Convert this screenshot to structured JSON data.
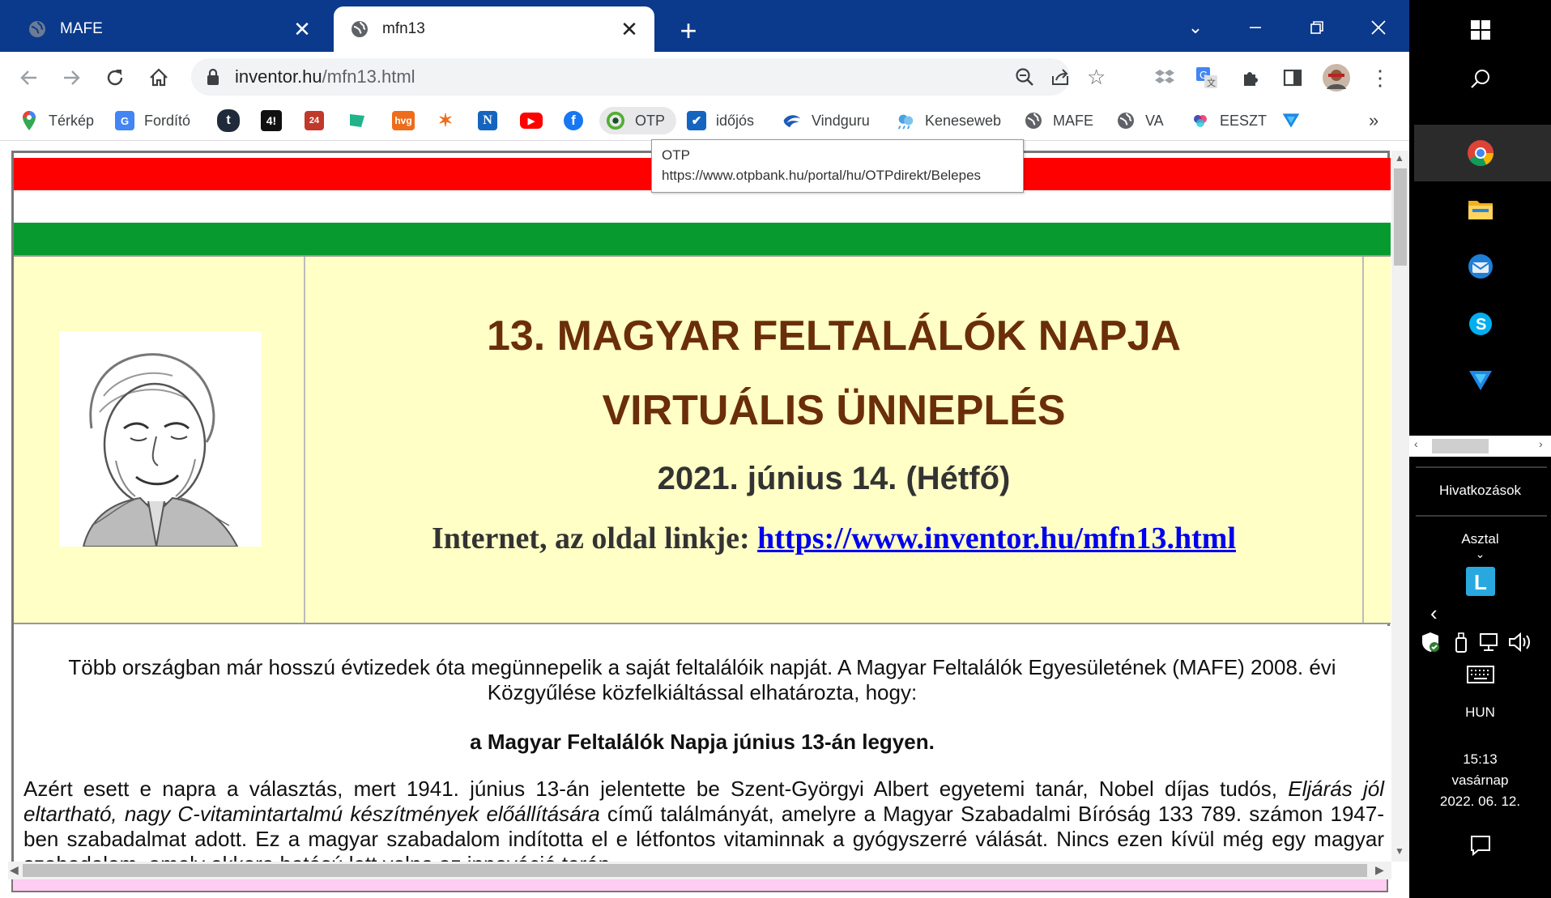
{
  "browser": {
    "tabs": [
      {
        "title": "MAFE",
        "active": false
      },
      {
        "title": "mfn13",
        "active": true
      }
    ],
    "new_tab_label": "+",
    "url_host": "inventor.hu",
    "url_path": "/mfn13.html",
    "bookmarks": [
      {
        "label": "Térkép",
        "icon": "maps-pin-icon"
      },
      {
        "label": "Fordító",
        "icon": "translate-icon"
      },
      {
        "label": "",
        "icon": "telex-icon"
      },
      {
        "label": "",
        "icon": "444-icon"
      },
      {
        "label": "",
        "icon": "24hu-icon"
      },
      {
        "label": "",
        "icon": "flag-icon"
      },
      {
        "label": "",
        "icon": "hvg-icon"
      },
      {
        "label": "",
        "icon": "star-burst-icon"
      },
      {
        "label": "",
        "icon": "n-icon"
      },
      {
        "label": "",
        "icon": "youtube-icon"
      },
      {
        "label": "",
        "icon": "facebook-icon"
      },
      {
        "label": "OTP",
        "icon": "otp-icon"
      },
      {
        "label": "időjós",
        "icon": "idojos-icon"
      },
      {
        "label": "Vindguru",
        "icon": "windguru-icon"
      },
      {
        "label": "Keneseweb",
        "icon": "weather-icon"
      },
      {
        "label": "MAFE",
        "icon": "globe-icon"
      },
      {
        "label": "VA",
        "icon": "globe-icon"
      },
      {
        "label": "EESZT",
        "icon": "eeszt-icon"
      },
      {
        "label": "",
        "icon": "triangle-logo-icon"
      }
    ],
    "more_bookmarks": "»",
    "tooltip": {
      "title": "OTP",
      "url": "https://www.otpbank.hu/portal/hu/OTPdirekt/Belepes"
    }
  },
  "page": {
    "title_line1": "13. MAGYAR FELTALÁLÓK NAPJA",
    "title_line2": "VIRTUÁLIS ÜNNEPLÉS",
    "date": "2021. június 14. (Hétfő)",
    "link_prefix": "Internet, az oldal linkje:",
    "link_url": "https://www.inventor.hu/mfn13.html",
    "para1": "Több országban már hosszú évtizedek óta megünnepelik a saját feltalálóik napját. A Magyar Feltalálók Egyesületének (MAFE) 2008. évi Közgyűlése közfelkiáltással elhatározta, hogy:",
    "para2": "a Magyar Feltalálók Napja június 13-án legyen.",
    "para3_a": "Azért esett e napra a választás, mert 1941. június 13-án jelentette be Szent-Györgyi Albert egyetemi tanár, Nobel díjas tudós, ",
    "para3_italic": "Eljárás jól eltartható, nagy C-vitamintartalmú készítmények előállítására",
    "para3_b": " című találmányát, amelyre a Magyar Szabadalmi Bíróság 133 789. számon 1947-ben szabadalmat adott. Ez a magyar szabadalom indította el e létfontos vitaminnak a gyógyszerré válását. Nincs ezen kívül még egy magyar szabadalom, amely akkora hatású lett volna az innováció terén."
  },
  "taskbar": {
    "links_label": "Hivatkozások",
    "desktop_label": "Asztal",
    "language": "HUN",
    "time": "15:13",
    "day": "vasárnap",
    "date": "2022. 06. 12."
  },
  "colors": {
    "tabstrip": "#0b3a8c",
    "flag_red": "#ff0000",
    "flag_green": "#079b2f",
    "header_bg": "#ffffc6",
    "title_brown": "#6b2e0a",
    "link_blue": "#0000ee"
  }
}
